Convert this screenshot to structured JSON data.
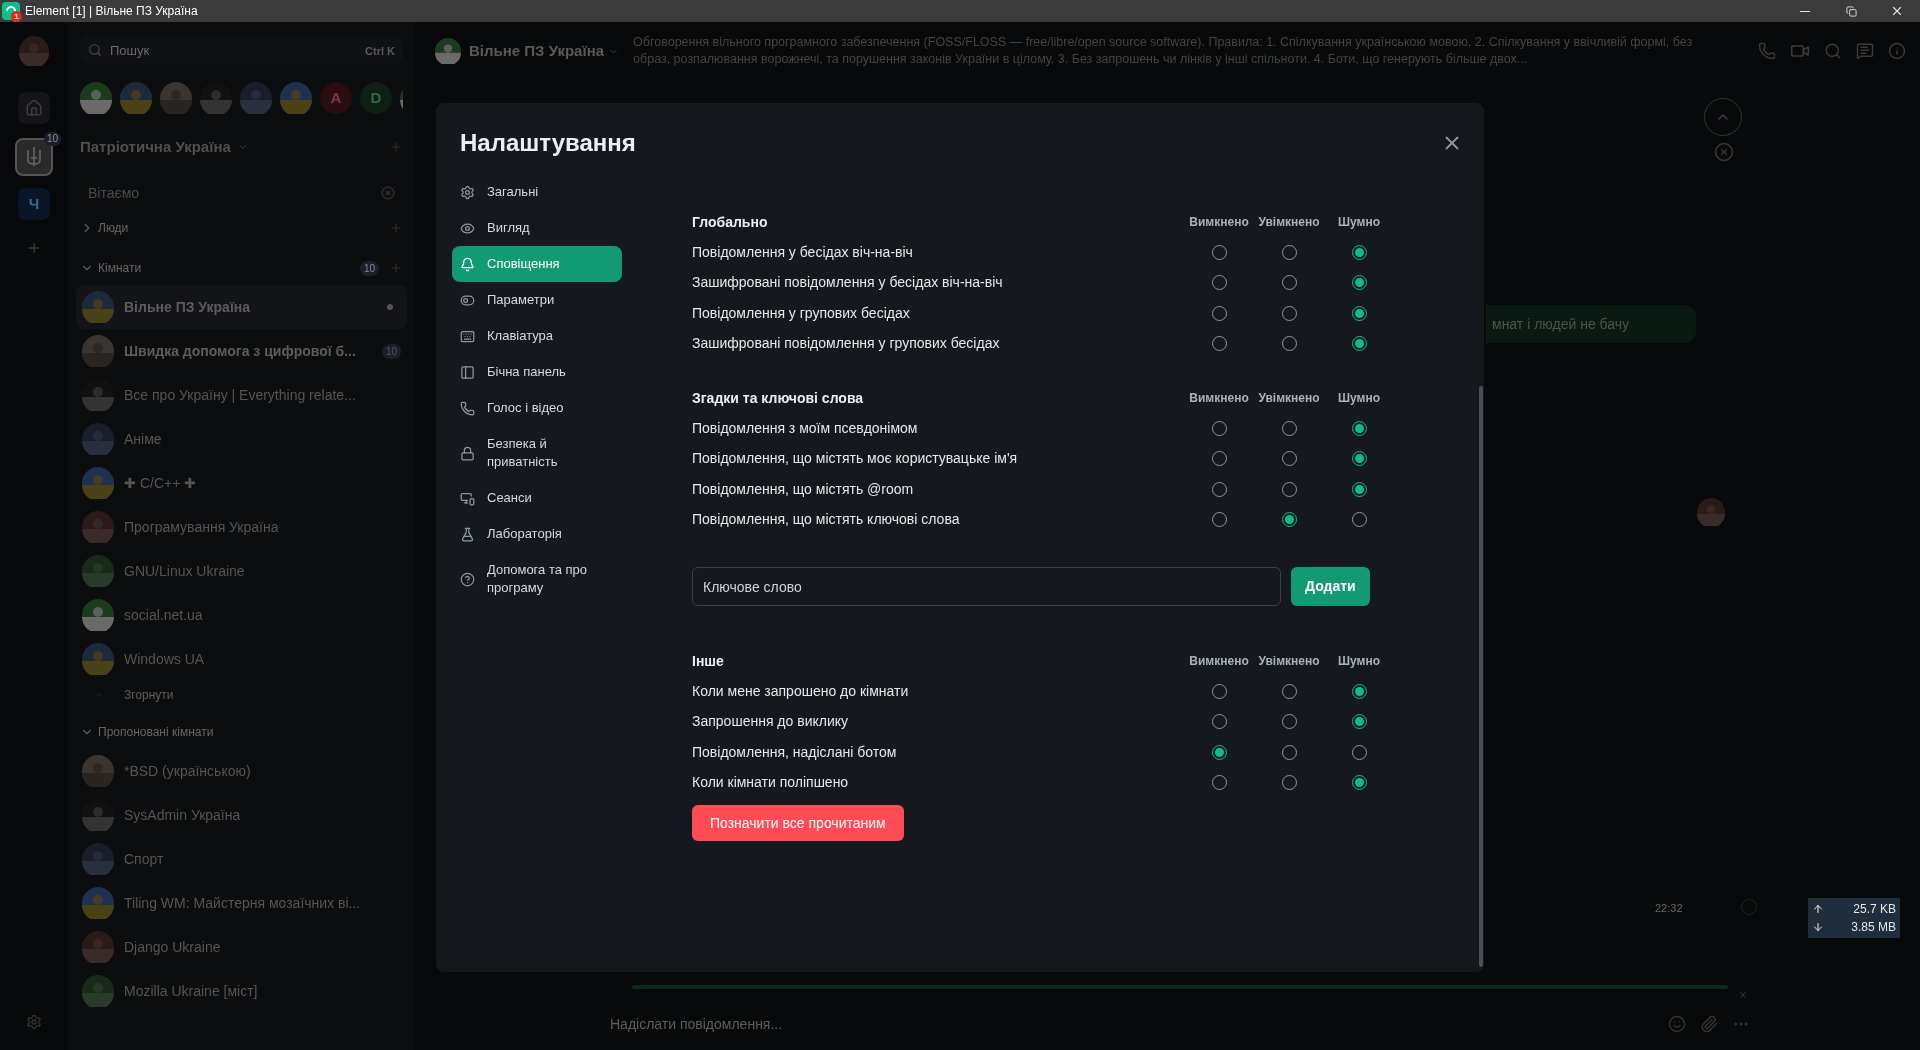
{
  "window": {
    "title": "Element [1] | Вільне ПЗ Україна",
    "app_badge": "1"
  },
  "spaces": [
    {
      "kind": "user",
      "selected": false
    },
    {
      "kind": "home",
      "selected": false
    },
    {
      "kind": "space",
      "selected": true,
      "badge": "10"
    },
    {
      "kind": "letter",
      "letter": "Ч",
      "selected": false
    },
    {
      "kind": "add",
      "selected": false
    }
  ],
  "room_list": {
    "search": {
      "placeholder": "Пошук",
      "shortcut": "Ctrl K"
    },
    "recent": [
      {
        "kind": "image"
      },
      {
        "kind": "image"
      },
      {
        "kind": "image"
      },
      {
        "kind": "image"
      },
      {
        "kind": "image"
      },
      {
        "kind": "image"
      },
      {
        "kind": "letter",
        "letter": "A"
      },
      {
        "kind": "letter",
        "letter": "D"
      },
      {
        "kind": "image"
      }
    ],
    "space_title": "Патріотична Україна",
    "welcome": "Вітаємо",
    "sections": [
      {
        "title": "Люди",
        "expanded": false,
        "add": true
      },
      {
        "title": "Кімнати",
        "expanded": true,
        "add": true,
        "badge": "10",
        "collapse_label": "Згорнути",
        "rooms": [
          {
            "name": "Вільне ПЗ Україна",
            "selected": true,
            "unread": true,
            "dot": true
          },
          {
            "name": "Швидка допомога з цифрової б...",
            "selected": false,
            "unread": true,
            "dot": false,
            "badge": "10"
          },
          {
            "name": "Все про Україну | Everything relate...",
            "selected": false,
            "unread": false,
            "dot": false
          },
          {
            "name": "Аніме",
            "selected": false,
            "unread": false,
            "dot": false
          },
          {
            "name": "✚ C/C++ ✚",
            "selected": false,
            "unread": false,
            "dot": false
          },
          {
            "name": "Програмування Україна",
            "selected": false,
            "unread": false,
            "dot": false
          },
          {
            "name": "GNU/Linux Ukraine",
            "selected": false,
            "unread": false,
            "dot": false
          },
          {
            "name": "social.net.ua",
            "selected": false,
            "unread": false,
            "dot": false
          },
          {
            "name": "Windows UA",
            "selected": false,
            "unread": false,
            "dot": false
          }
        ]
      },
      {
        "title": "Пропоновані кімнати",
        "expanded": true,
        "add": false,
        "rooms": [
          {
            "name": "*BSD (українською)",
            "selected": false,
            "unread": false,
            "dot": false
          },
          {
            "name": "SysAdmin Україна",
            "selected": false,
            "unread": false,
            "dot": false
          },
          {
            "name": "Спорт",
            "selected": false,
            "unread": false,
            "dot": false
          },
          {
            "name": "Tiling WM: Майстерня мозаїчних ві...",
            "selected": false,
            "unread": false,
            "dot": false
          },
          {
            "name": "Django Ukraine",
            "selected": false,
            "unread": false,
            "dot": false
          },
          {
            "name": "Mozilla Ukraine [міст]",
            "selected": false,
            "unread": false,
            "dot": false
          }
        ]
      }
    ]
  },
  "room_header": {
    "name": "Вільне ПЗ Україна",
    "topic": "Обговорення вільного програмного забезпечення (FOSS/FLOSS — free/libre/open source software). Правила: 1. Спілкування українською мовою. 2. Спілкування у ввічливій формі, без образ, розпалювання ворожнечі, та порушення законів України в цілому. 3. Без запрошень чи лінків у інші спільноти. 4. Боти, що генерують більше двох..."
  },
  "timeline": {
    "message": "мнат і людей не бачу",
    "time": "22:32"
  },
  "network": {
    "upload": "25.7 KB",
    "download": "3.85 MB"
  },
  "composer": {
    "placeholder": "Надіслати повідомлення..."
  },
  "settings": {
    "title": "Налаштування",
    "nav": [
      {
        "label": "Загальні",
        "kind": "gear",
        "selected": false
      },
      {
        "label": "Вигляд",
        "kind": "eye",
        "selected": false
      },
      {
        "label": "Сповіщення",
        "kind": "bell",
        "selected": true
      },
      {
        "label": "Параметри",
        "kind": "toggle",
        "selected": false
      },
      {
        "label": "Клавіатура",
        "kind": "keyboard",
        "selected": false
      },
      {
        "label": "Бічна панель",
        "kind": "sidebar",
        "selected": false
      },
      {
        "label": "Голос і відео",
        "kind": "phone",
        "selected": false
      },
      {
        "label": "Безпека й приватність",
        "kind": "lock",
        "selected": false
      },
      {
        "label": "Сеанси",
        "kind": "devices",
        "selected": false
      },
      {
        "label": "Лабораторія",
        "kind": "flask",
        "selected": false
      },
      {
        "label": "Допомога та про програму",
        "kind": "help",
        "selected": false
      }
    ],
    "sections": [
      {
        "title": "Глобально",
        "columns": [
          "Вимкнено",
          "Увімкнено",
          "Шумно"
        ],
        "rows": [
          {
            "label": "Повідомлення у бесідах віч-на-віч",
            "options": [
              {
                "selected": false
              },
              {
                "selected": false
              },
              {
                "selected": true
              }
            ]
          },
          {
            "label": "Зашифровані повідомлення у бесідах віч-на-віч",
            "options": [
              {
                "selected": false
              },
              {
                "selected": false
              },
              {
                "selected": true
              }
            ]
          },
          {
            "label": "Повідомлення у групових бесідах",
            "options": [
              {
                "selected": false
              },
              {
                "selected": false
              },
              {
                "selected": true
              }
            ]
          },
          {
            "label": "Зашифровані повідомлення у групових бесідах",
            "options": [
              {
                "selected": false
              },
              {
                "selected": false
              },
              {
                "selected": true
              }
            ]
          }
        ]
      },
      {
        "title": "Згадки та ключові слова",
        "columns": [
          "Вимкнено",
          "Увімкнено",
          "Шумно"
        ],
        "rows": [
          {
            "label": "Повідомлення з моїм псевдонімом",
            "options": [
              {
                "selected": false
              },
              {
                "selected": false
              },
              {
                "selected": true
              }
            ]
          },
          {
            "label": "Повідомлення, що містять моє користувацьке ім'я",
            "options": [
              {
                "selected": false
              },
              {
                "selected": false
              },
              {
                "selected": true
              }
            ]
          },
          {
            "label": "Повідомлення, що містять @room",
            "options": [
              {
                "selected": false
              },
              {
                "selected": false
              },
              {
                "selected": true
              }
            ]
          },
          {
            "label": "Повідомлення, що містять ключові слова",
            "options": [
              {
                "selected": false
              },
              {
                "selected": true
              },
              {
                "selected": false
              }
            ]
          }
        ],
        "keyword": {
          "placeholder": "Ключове слово",
          "button": "Додати"
        }
      },
      {
        "title": "Інше",
        "columns": [
          "Вимкнено",
          "Увімкнено",
          "Шумно"
        ],
        "rows": [
          {
            "label": "Коли мене запрошено до кімнати",
            "options": [
              {
                "selected": false
              },
              {
                "selected": false
              },
              {
                "selected": true
              }
            ]
          },
          {
            "label": "Запрошення до виклику",
            "options": [
              {
                "selected": false
              },
              {
                "selected": false
              },
              {
                "selected": true
              }
            ]
          },
          {
            "label": "Повідомлення, надіслані ботом",
            "options": [
              {
                "selected": true
              },
              {
                "selected": false
              },
              {
                "selected": false
              }
            ]
          },
          {
            "label": "Коли кімнати поліпшено",
            "options": [
              {
                "selected": false
              },
              {
                "selected": false
              },
              {
                "selected": true
              }
            ]
          }
        ]
      }
    ],
    "mark_all_read": "Позначити все прочитаним"
  }
}
